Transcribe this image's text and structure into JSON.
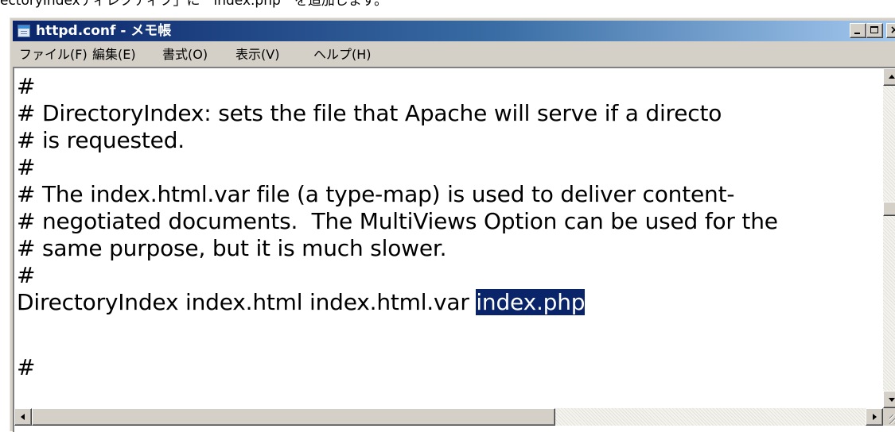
{
  "caption": "ectoryIndexディレクティブ」に　index.php　を追加します。",
  "window": {
    "title": "httpd.conf - メモ帳",
    "app_icon": "notepad-icon",
    "controls": {
      "minimize": "minimize-icon",
      "maximize": "maximize-icon",
      "close_label": "×"
    }
  },
  "menu": {
    "file": "ファイル(F)",
    "edit": "編集(E)",
    "format": "書式(O)",
    "view": "表示(V)",
    "help": "ヘルプ(H)"
  },
  "editor": {
    "lines": [
      "#",
      "# DirectoryIndex: sets the file that Apache will serve if a directo",
      "# is requested.",
      "#",
      "# The index.html.var file (a type-map) is used to deliver content-",
      "# negotiated documents.  The MultiViews Option can be used for the",
      "# same purpose, but it is much slower.",
      "#",
      "DirectoryIndex index.html index.html.var ",
      "",
      "#"
    ],
    "selected_text": "index.php",
    "selection_color": "#0a246a"
  },
  "scrollbars": {
    "vertical": {
      "position": 0.4
    },
    "horizontal": {
      "position": 0.0
    }
  }
}
